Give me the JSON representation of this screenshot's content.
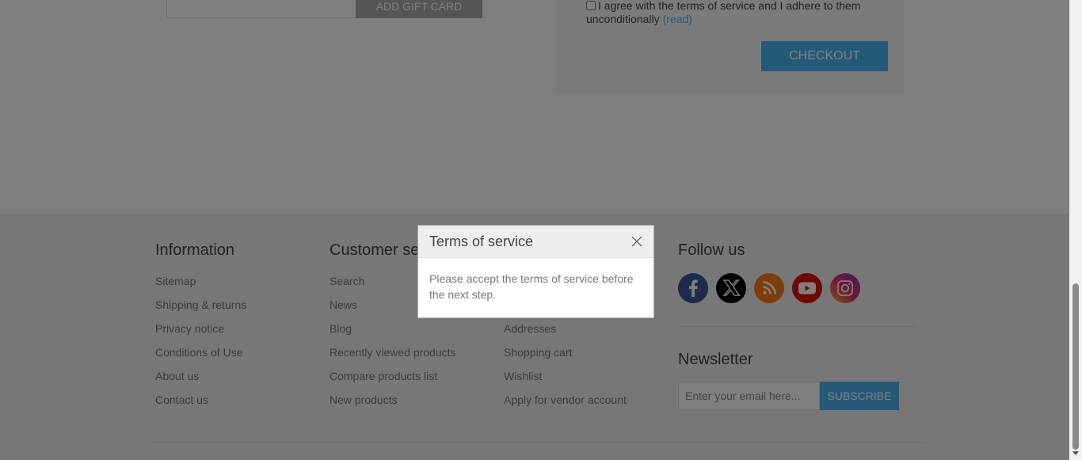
{
  "cart": {
    "gift_button": "ADD GIFT CARD",
    "terms_text": "I agree with the terms of service and I adhere to them unconditionally",
    "read_link": "(read)",
    "checkout_button": "CHECKOUT"
  },
  "footer": {
    "information": {
      "title": "Information",
      "links": [
        "Sitemap",
        "Shipping & returns",
        "Privacy notice",
        "Conditions of Use",
        "About us",
        "Contact us"
      ]
    },
    "customer_service": {
      "title": "Customer se",
      "links": [
        "Search",
        "News",
        "Blog",
        "Recently viewed products",
        "Compare products list",
        "New products"
      ]
    },
    "my_account": {
      "links": [
        "Addresses",
        "Shopping cart",
        "Wishlist",
        "Apply for vendor account"
      ]
    },
    "follow": {
      "title": "Follow us",
      "icons": [
        "facebook-icon",
        "x-icon",
        "rss-icon",
        "youtube-icon",
        "instagram-icon"
      ]
    },
    "newsletter": {
      "title": "Newsletter",
      "placeholder": "Enter your email here...",
      "subscribe": "SUBSCRIBE"
    }
  },
  "dialog": {
    "title": "Terms of service",
    "message": "Please accept the terms of service before the next step."
  },
  "colors": {
    "accent": "#4ab2f1",
    "facebook": "#3b5998",
    "x": "#000000",
    "rss": "#fe7a16",
    "youtube": "#e20c0b"
  }
}
